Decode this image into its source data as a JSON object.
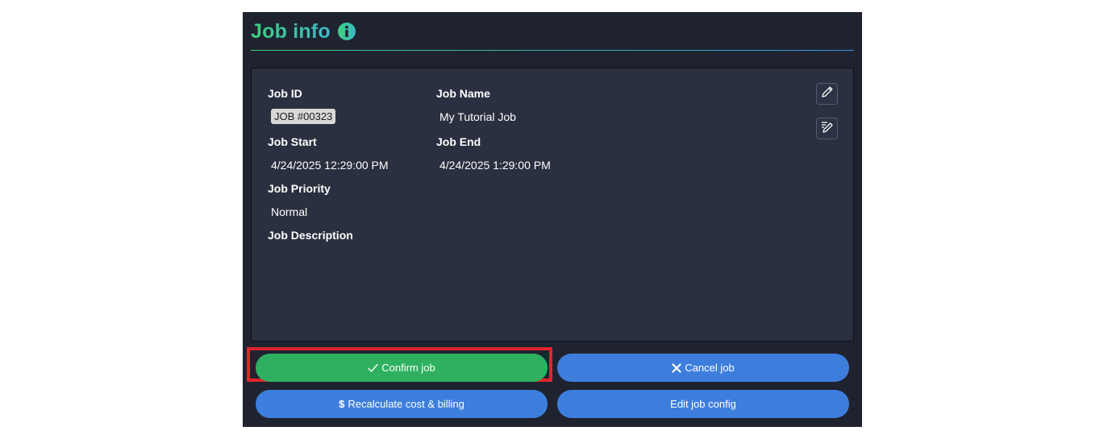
{
  "colors": {
    "panel_bg": "#1f2330",
    "details_bg": "#2a303f",
    "title_gradient_start": "#3ecf7a",
    "title_gradient_end": "#3fb8c9",
    "confirm_green": "#2eb060",
    "blue_button": "#3d7edd",
    "highlight_red": "#e2242b"
  },
  "header": {
    "title": "Job info",
    "icon": "info-circle-icon"
  },
  "details": {
    "job_id_label": "Job ID",
    "job_id_value": "JOB #00323",
    "job_name_label": "Job Name",
    "job_name_value": "My Tutorial Job",
    "job_start_label": "Job Start",
    "job_start_value": "4/24/2025 12:29:00 PM",
    "job_end_label": "Job End",
    "job_end_value": "4/24/2025 1:29:00 PM",
    "job_priority_label": "Job Priority",
    "job_priority_value": "Normal",
    "job_description_label": "Job Description",
    "edit_icon": "pencil-icon",
    "edit_notes_icon": "pencil-lines-icon"
  },
  "actions": {
    "confirm_label": "Confirm job",
    "confirm_icon": "checkmark-icon",
    "cancel_label": "Cancel job",
    "cancel_icon": "close-icon",
    "recalculate_label": "Recalculate cost & billing",
    "recalculate_icon": "dollar-icon",
    "recalculate_glyph": "$",
    "edit_config_label": "Edit job config"
  }
}
